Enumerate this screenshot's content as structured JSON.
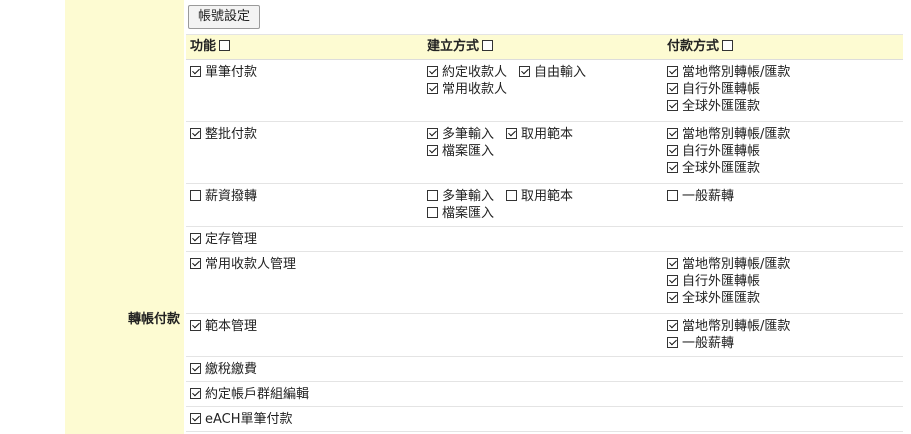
{
  "section_label": "轉帳付款",
  "account_button": "帳號設定",
  "headers": {
    "function": "功能",
    "method": "建立方式",
    "payment": "付款方式"
  },
  "rows": [
    {
      "function": {
        "label": "單筆付款",
        "checked": true
      },
      "methods": [
        [
          {
            "label": "約定收款人",
            "checked": true
          },
          {
            "label": "自由輸入",
            "checked": true
          }
        ],
        [
          {
            "label": "常用收款人",
            "checked": true
          }
        ]
      ],
      "payments": [
        {
          "label": "當地幣別轉帳/匯款",
          "checked": true
        },
        {
          "label": "自行外匯轉帳",
          "checked": true
        },
        {
          "label": "全球外匯匯款",
          "checked": true
        }
      ]
    },
    {
      "function": {
        "label": "整批付款",
        "checked": true
      },
      "methods": [
        [
          {
            "label": "多筆輸入",
            "checked": true
          },
          {
            "label": "取用範本",
            "checked": true
          }
        ],
        [
          {
            "label": "檔案匯入",
            "checked": true
          }
        ]
      ],
      "payments": [
        {
          "label": "當地幣別轉帳/匯款",
          "checked": true
        },
        {
          "label": "自行外匯轉帳",
          "checked": true
        },
        {
          "label": "全球外匯匯款",
          "checked": true
        }
      ]
    },
    {
      "function": {
        "label": "薪資撥轉",
        "checked": false
      },
      "methods": [
        [
          {
            "label": "多筆輸入",
            "checked": false
          },
          {
            "label": "取用範本",
            "checked": false
          }
        ],
        [
          {
            "label": "檔案匯入",
            "checked": false
          }
        ]
      ],
      "payments": [
        {
          "label": "一般薪轉",
          "checked": false
        }
      ]
    },
    {
      "function": {
        "label": "定存管理",
        "checked": true
      },
      "methods": [],
      "payments": []
    },
    {
      "function": {
        "label": "常用收款人管理",
        "checked": true
      },
      "methods": [],
      "payments": [
        {
          "label": "當地幣別轉帳/匯款",
          "checked": true
        },
        {
          "label": "自行外匯轉帳",
          "checked": true
        },
        {
          "label": "全球外匯匯款",
          "checked": true
        }
      ]
    },
    {
      "function": {
        "label": "範本管理",
        "checked": true
      },
      "methods": [],
      "payments": [
        {
          "label": "當地幣別轉帳/匯款",
          "checked": true
        },
        {
          "label": "一般薪轉",
          "checked": true
        }
      ]
    },
    {
      "function": {
        "label": "繳稅繳費",
        "checked": true
      },
      "methods": [],
      "payments": []
    },
    {
      "function": {
        "label": "約定帳戶群組編輯",
        "checked": true
      },
      "methods": [],
      "payments": []
    },
    {
      "function": {
        "label": "eACH單筆付款",
        "checked": true
      },
      "methods": [],
      "payments": []
    }
  ]
}
